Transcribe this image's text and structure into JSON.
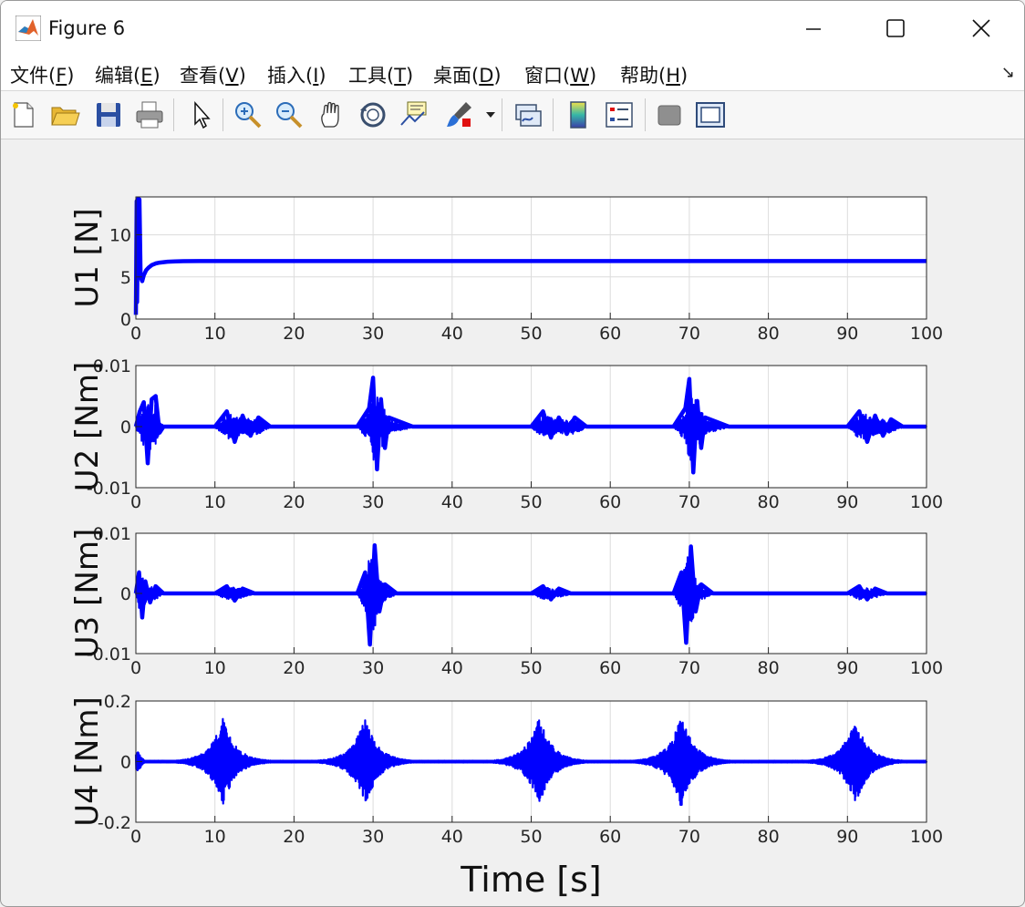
{
  "window": {
    "title": "Figure 6"
  },
  "menu": [
    {
      "label": "文件(",
      "key": "F",
      "suffix": ")"
    },
    {
      "label": "编辑(",
      "key": "E",
      "suffix": ")"
    },
    {
      "label": "查看(",
      "key": "V",
      "suffix": ")"
    },
    {
      "label": "插入(",
      "key": "I",
      "suffix": ")"
    },
    {
      "label": "工具(",
      "key": "T",
      "suffix": ")"
    },
    {
      "label": "桌面(",
      "key": "D",
      "suffix": ")"
    },
    {
      "label": "窗口(",
      "key": "W",
      "suffix": ")"
    },
    {
      "label": "帮助(",
      "key": "H",
      "suffix": ")"
    }
  ],
  "menu_arrow": "↘",
  "toolbar": [
    "new-figure-icon",
    "open-icon",
    "save-icon",
    "print-icon",
    "pointer-icon",
    "zoom-in-icon",
    "zoom-out-icon",
    "pan-icon",
    "rotate-icon",
    "data-cursor-icon",
    "brush-icon",
    "brush-dropdown-icon",
    "link-plot-icon",
    "colorbar-icon",
    "legend-icon",
    "hide-plot-tools-icon",
    "show-plot-tools-icon"
  ],
  "colors": {
    "series": "#0000ff",
    "grid": "#dcdcdc",
    "axis": "#262626"
  },
  "chart_data": [
    {
      "type": "line",
      "ylabel": "U1 [N]",
      "xlim": [
        0,
        100
      ],
      "ylim": [
        0,
        14.5
      ],
      "xticks": [
        0,
        10,
        20,
        30,
        40,
        50,
        60,
        70,
        80,
        90,
        100
      ],
      "yticks": [
        0,
        5,
        10
      ],
      "ytick_labels": [
        "0",
        "5",
        "10"
      ],
      "grid": true,
      "series": [
        {
          "x": [
            0,
            0.1,
            0.15,
            0.3,
            0.35,
            0.45,
            0.6,
            0.8,
            1.0,
            1.3,
            1.6,
            2,
            2.5,
            3,
            4,
            5,
            6,
            8,
            10,
            20,
            50,
            100
          ],
          "y": [
            0.5,
            14,
            2,
            14.3,
            6.5,
            14.2,
            5,
            4.5,
            5.2,
            5.8,
            6.1,
            6.4,
            6.6,
            6.7,
            6.8,
            6.85,
            6.87,
            6.88,
            6.88,
            6.88,
            6.88,
            6.88
          ]
        }
      ]
    },
    {
      "type": "line",
      "ylabel": "U2 [Nm]",
      "xlim": [
        0,
        100
      ],
      "ylim": [
        -0.01,
        0.01
      ],
      "xticks": [
        0,
        10,
        20,
        30,
        40,
        50,
        60,
        70,
        80,
        90,
        100
      ],
      "yticks": [
        -0.01,
        0,
        0.01
      ],
      "ytick_labels": [
        "-0.01",
        "0",
        "0.01"
      ],
      "grid": true,
      "series": [
        {
          "x": [
            0,
            0.5,
            1.0,
            1.5,
            2.0,
            2.5,
            3.0,
            3.5,
            5,
            10,
            11.5,
            12.5,
            13.5,
            14.5,
            15.5,
            17,
            28,
            29.5,
            30.0,
            30.5,
            31.0,
            31.5,
            32,
            35,
            50,
            51.5,
            52.5,
            53.5,
            54.5,
            55.5,
            57,
            68,
            69.5,
            70.0,
            70.5,
            71.0,
            71.5,
            72,
            75,
            90,
            91.5,
            92.5,
            93.5,
            94.5,
            95.5,
            97,
            100
          ],
          "y": [
            0,
            0.0025,
            0.004,
            -0.006,
            0.0045,
            0.005,
            -0.001,
            0,
            0,
            0,
            0.0025,
            -0.0025,
            0.0018,
            -0.0015,
            0.0015,
            0,
            0,
            0.003,
            0.008,
            -0.007,
            0.0045,
            -0.0035,
            0.0015,
            0,
            0,
            0.0025,
            -0.0018,
            0.0015,
            -0.0012,
            0.0015,
            0,
            0,
            0.003,
            0.0078,
            -0.0075,
            0.0042,
            -0.0035,
            0.0015,
            0,
            0,
            0.0025,
            -0.0025,
            0.0018,
            -0.0015,
            0.0012,
            0,
            0
          ]
        }
      ]
    },
    {
      "type": "line",
      "ylabel": "U3 [Nm]",
      "xlim": [
        0,
        100
      ],
      "ylim": [
        -0.01,
        0.01
      ],
      "xticks": [
        0,
        10,
        20,
        30,
        40,
        50,
        60,
        70,
        80,
        90,
        100
      ],
      "yticks": [
        -0.01,
        0,
        0.01
      ],
      "ytick_labels": [
        "-0.01",
        "0",
        "0.01"
      ],
      "grid": true,
      "series": [
        {
          "x": [
            0,
            0.4,
            0.8,
            1.2,
            1.8,
            2.5,
            3.5,
            5,
            10,
            11.5,
            12.5,
            13.5,
            15,
            28,
            29.0,
            29.6,
            30.2,
            30.8,
            31.5,
            33,
            50,
            51.5,
            52.5,
            53.5,
            55,
            68,
            69.0,
            69.6,
            70.2,
            70.8,
            71.5,
            73,
            90,
            91.5,
            92.5,
            93.5,
            95,
            100
          ],
          "y": [
            0,
            0.0035,
            -0.004,
            0.002,
            -0.0015,
            0.0012,
            0,
            0,
            0,
            0.0012,
            -0.0012,
            0.0008,
            0,
            0,
            0.0035,
            -0.0085,
            0.008,
            -0.003,
            0.0015,
            0,
            0,
            0.0012,
            -0.001,
            0.0008,
            0,
            0,
            0.0035,
            -0.0082,
            0.0078,
            -0.003,
            0.0015,
            0,
            0,
            0.0012,
            -0.001,
            0.0008,
            0,
            0
          ]
        }
      ]
    },
    {
      "type": "line",
      "ylabel": "U4 [Nm]",
      "xlabel": "Time [s]",
      "xlim": [
        0,
        100
      ],
      "ylim": [
        -0.2,
        0.2
      ],
      "xticks": [
        0,
        10,
        20,
        30,
        40,
        50,
        60,
        70,
        80,
        90,
        100
      ],
      "yticks": [
        -0.2,
        0,
        0.2
      ],
      "ytick_labels": [
        "-0.2",
        "0",
        "0.2"
      ],
      "grid": true,
      "series": [
        {
          "bursts": [
            {
              "center": 11,
              "amp": 0.145
            },
            {
              "center": 29,
              "amp": 0.15
            },
            {
              "center": 51,
              "amp": 0.15
            },
            {
              "center": 69,
              "amp": 0.155
            },
            {
              "center": 91,
              "amp": 0.145
            }
          ],
          "initial_amp": 0.04
        }
      ]
    }
  ]
}
